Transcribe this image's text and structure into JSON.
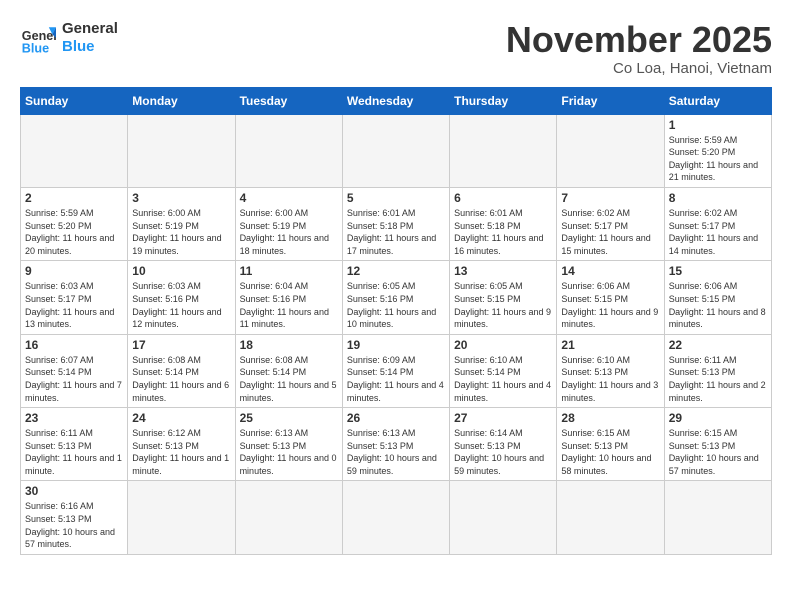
{
  "header": {
    "logo_general": "General",
    "logo_blue": "Blue",
    "month": "November 2025",
    "location": "Co Loa, Hanoi, Vietnam"
  },
  "weekdays": [
    "Sunday",
    "Monday",
    "Tuesday",
    "Wednesday",
    "Thursday",
    "Friday",
    "Saturday"
  ],
  "weeks": [
    [
      {
        "day": "",
        "info": ""
      },
      {
        "day": "",
        "info": ""
      },
      {
        "day": "",
        "info": ""
      },
      {
        "day": "",
        "info": ""
      },
      {
        "day": "",
        "info": ""
      },
      {
        "day": "",
        "info": ""
      },
      {
        "day": "1",
        "info": "Sunrise: 5:59 AM\nSunset: 5:20 PM\nDaylight: 11 hours and 21 minutes."
      }
    ],
    [
      {
        "day": "2",
        "info": "Sunrise: 5:59 AM\nSunset: 5:20 PM\nDaylight: 11 hours and 20 minutes."
      },
      {
        "day": "3",
        "info": "Sunrise: 6:00 AM\nSunset: 5:19 PM\nDaylight: 11 hours and 19 minutes."
      },
      {
        "day": "4",
        "info": "Sunrise: 6:00 AM\nSunset: 5:19 PM\nDaylight: 11 hours and 18 minutes."
      },
      {
        "day": "5",
        "info": "Sunrise: 6:01 AM\nSunset: 5:18 PM\nDaylight: 11 hours and 17 minutes."
      },
      {
        "day": "6",
        "info": "Sunrise: 6:01 AM\nSunset: 5:18 PM\nDaylight: 11 hours and 16 minutes."
      },
      {
        "day": "7",
        "info": "Sunrise: 6:02 AM\nSunset: 5:17 PM\nDaylight: 11 hours and 15 minutes."
      },
      {
        "day": "8",
        "info": "Sunrise: 6:02 AM\nSunset: 5:17 PM\nDaylight: 11 hours and 14 minutes."
      }
    ],
    [
      {
        "day": "9",
        "info": "Sunrise: 6:03 AM\nSunset: 5:17 PM\nDaylight: 11 hours and 13 minutes."
      },
      {
        "day": "10",
        "info": "Sunrise: 6:03 AM\nSunset: 5:16 PM\nDaylight: 11 hours and 12 minutes."
      },
      {
        "day": "11",
        "info": "Sunrise: 6:04 AM\nSunset: 5:16 PM\nDaylight: 11 hours and 11 minutes."
      },
      {
        "day": "12",
        "info": "Sunrise: 6:05 AM\nSunset: 5:16 PM\nDaylight: 11 hours and 10 minutes."
      },
      {
        "day": "13",
        "info": "Sunrise: 6:05 AM\nSunset: 5:15 PM\nDaylight: 11 hours and 9 minutes."
      },
      {
        "day": "14",
        "info": "Sunrise: 6:06 AM\nSunset: 5:15 PM\nDaylight: 11 hours and 9 minutes."
      },
      {
        "day": "15",
        "info": "Sunrise: 6:06 AM\nSunset: 5:15 PM\nDaylight: 11 hours and 8 minutes."
      }
    ],
    [
      {
        "day": "16",
        "info": "Sunrise: 6:07 AM\nSunset: 5:14 PM\nDaylight: 11 hours and 7 minutes."
      },
      {
        "day": "17",
        "info": "Sunrise: 6:08 AM\nSunset: 5:14 PM\nDaylight: 11 hours and 6 minutes."
      },
      {
        "day": "18",
        "info": "Sunrise: 6:08 AM\nSunset: 5:14 PM\nDaylight: 11 hours and 5 minutes."
      },
      {
        "day": "19",
        "info": "Sunrise: 6:09 AM\nSunset: 5:14 PM\nDaylight: 11 hours and 4 minutes."
      },
      {
        "day": "20",
        "info": "Sunrise: 6:10 AM\nSunset: 5:14 PM\nDaylight: 11 hours and 4 minutes."
      },
      {
        "day": "21",
        "info": "Sunrise: 6:10 AM\nSunset: 5:13 PM\nDaylight: 11 hours and 3 minutes."
      },
      {
        "day": "22",
        "info": "Sunrise: 6:11 AM\nSunset: 5:13 PM\nDaylight: 11 hours and 2 minutes."
      }
    ],
    [
      {
        "day": "23",
        "info": "Sunrise: 6:11 AM\nSunset: 5:13 PM\nDaylight: 11 hours and 1 minute."
      },
      {
        "day": "24",
        "info": "Sunrise: 6:12 AM\nSunset: 5:13 PM\nDaylight: 11 hours and 1 minute."
      },
      {
        "day": "25",
        "info": "Sunrise: 6:13 AM\nSunset: 5:13 PM\nDaylight: 11 hours and 0 minutes."
      },
      {
        "day": "26",
        "info": "Sunrise: 6:13 AM\nSunset: 5:13 PM\nDaylight: 10 hours and 59 minutes."
      },
      {
        "day": "27",
        "info": "Sunrise: 6:14 AM\nSunset: 5:13 PM\nDaylight: 10 hours and 59 minutes."
      },
      {
        "day": "28",
        "info": "Sunrise: 6:15 AM\nSunset: 5:13 PM\nDaylight: 10 hours and 58 minutes."
      },
      {
        "day": "29",
        "info": "Sunrise: 6:15 AM\nSunset: 5:13 PM\nDaylight: 10 hours and 57 minutes."
      }
    ],
    [
      {
        "day": "30",
        "info": "Sunrise: 6:16 AM\nSunset: 5:13 PM\nDaylight: 10 hours and 57 minutes."
      },
      {
        "day": "",
        "info": ""
      },
      {
        "day": "",
        "info": ""
      },
      {
        "day": "",
        "info": ""
      },
      {
        "day": "",
        "info": ""
      },
      {
        "day": "",
        "info": ""
      },
      {
        "day": "",
        "info": ""
      }
    ]
  ]
}
